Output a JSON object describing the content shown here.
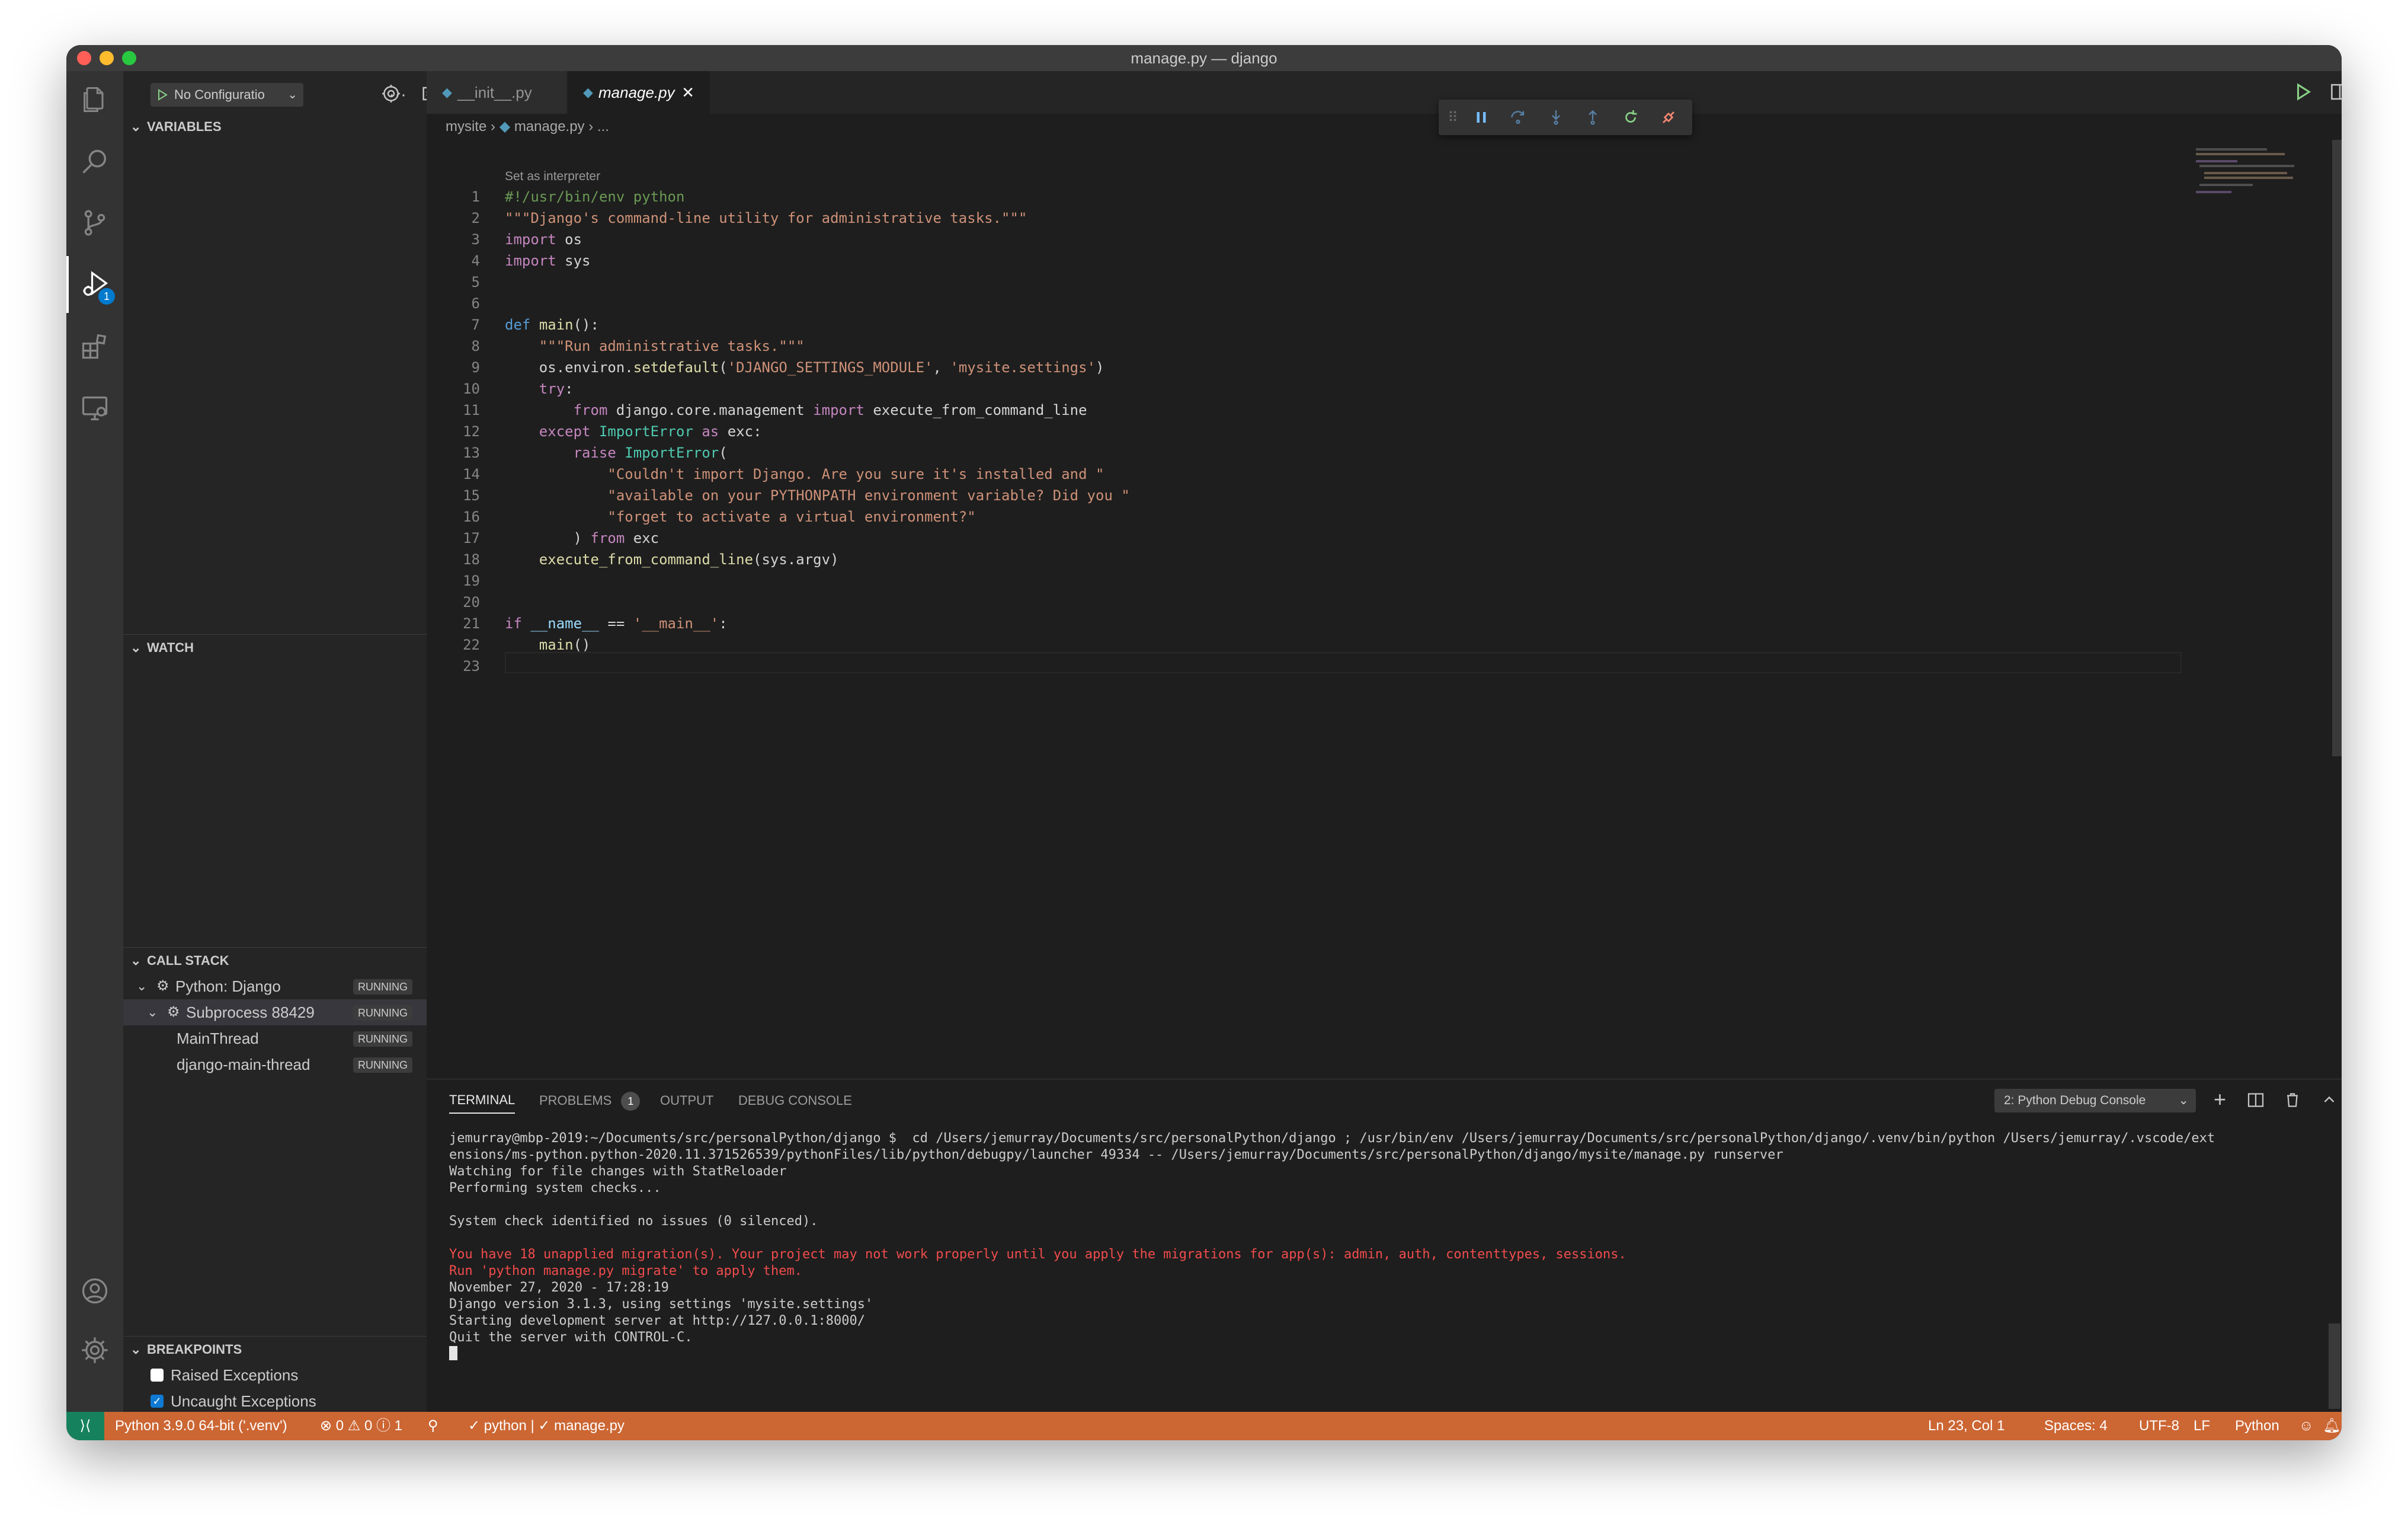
{
  "window": {
    "title": "manage.py — django",
    "traffic_colors": [
      "#ff5f57",
      "#febc2e",
      "#28c840"
    ]
  },
  "activity_bar": {
    "items": [
      {
        "name": "explorer-icon"
      },
      {
        "name": "search-icon"
      },
      {
        "name": "source-control-icon"
      },
      {
        "name": "run-debug-icon",
        "badge": "1"
      },
      {
        "name": "extensions-icon"
      },
      {
        "name": "remote-explorer-icon"
      }
    ],
    "bottom": [
      {
        "name": "accounts-icon"
      },
      {
        "name": "settings-gear-icon"
      }
    ]
  },
  "debug_toolbar": {
    "config_label": "No Configuratio"
  },
  "sidebar": {
    "variables": "VARIABLES",
    "watch": "WATCH",
    "call_stack": {
      "title": "CALL STACK",
      "rows": [
        {
          "label": "Python: Django",
          "status": "RUNNING"
        },
        {
          "label": "Subprocess 88429",
          "status": "RUNNING"
        },
        {
          "label": "MainThread",
          "status": "RUNNING"
        },
        {
          "label": "django-main-thread",
          "status": "RUNNING"
        }
      ]
    },
    "breakpoints": {
      "title": "BREAKPOINTS",
      "items": [
        {
          "label": "Raised Exceptions",
          "checked": false
        },
        {
          "label": "Uncaught Exceptions",
          "checked": true
        }
      ]
    }
  },
  "tabs": [
    {
      "label": "__init__.py",
      "active": false
    },
    {
      "label": "manage.py",
      "active": true
    }
  ],
  "breadcrumb": {
    "folder": "mysite",
    "file": "manage.py",
    "rest": "..."
  },
  "editor": {
    "hint": "Set as interpreter",
    "lines": [
      "#!/usr/bin/env python",
      "\"\"\"Django's command-line utility for administrative tasks.\"\"\"",
      "import os",
      "import sys",
      "",
      "",
      "def main():",
      "    \"\"\"Run administrative tasks.\"\"\"",
      "    os.environ.setdefault('DJANGO_SETTINGS_MODULE', 'mysite.settings')",
      "    try:",
      "        from django.core.management import execute_from_command_line",
      "    except ImportError as exc:",
      "        raise ImportError(",
      "            \"Couldn't import Django. Are you sure it's installed and \"",
      "            \"available on your PYTHONPATH environment variable? Did you \"",
      "            \"forget to activate a virtual environment?\"",
      "        ) from exc",
      "    execute_from_command_line(sys.argv)",
      "",
      "",
      "if __name__ == '__main__':",
      "    main()",
      ""
    ]
  },
  "panel": {
    "tabs": [
      "TERMINAL",
      "PROBLEMS",
      "OUTPUT",
      "DEBUG CONSOLE"
    ],
    "problems_count": "1",
    "console_select": "2: Python Debug Console",
    "terminal_lines": [
      {
        "text": "jemurray@mbp-2019:~/Documents/src/personalPython/django $  cd /Users/jemurray/Documents/src/personalPython/django ; /usr/bin/env /Users/jemurray/Documents/src/personalPython/django/.venv/bin/python /Users/jemurray/.vscode/ext",
        "color": "normal"
      },
      {
        "text": "ensions/ms-python.python-2020.11.371526539/pythonFiles/lib/python/debugpy/launcher 49334 -- /Users/jemurray/Documents/src/personalPython/django/mysite/manage.py runserver",
        "color": "normal"
      },
      {
        "text": "Watching for file changes with StatReloader",
        "color": "normal"
      },
      {
        "text": "Performing system checks...",
        "color": "normal"
      },
      {
        "text": "",
        "color": "normal"
      },
      {
        "text": "System check identified no issues (0 silenced).",
        "color": "normal"
      },
      {
        "text": "",
        "color": "normal"
      },
      {
        "text": "You have 18 unapplied migration(s). Your project may not work properly until you apply the migrations for app(s): admin, auth, contenttypes, sessions.",
        "color": "error"
      },
      {
        "text": "Run 'python manage.py migrate' to apply them.",
        "color": "error"
      },
      {
        "text": "November 27, 2020 - 17:28:19",
        "color": "normal"
      },
      {
        "text": "Django version 3.1.3, using settings 'mysite.settings'",
        "color": "normal"
      },
      {
        "text": "Starting development server at http://127.0.0.1:8000/",
        "color": "normal"
      },
      {
        "text": "Quit the server with CONTROL-C.",
        "color": "normal"
      }
    ]
  },
  "status_bar": {
    "interpreter": "Python 3.9.0 64-bit ('.venv')",
    "problems": "⊗ 0 ⚠ 0 ⓘ 1",
    "run_info": "✓ python | ✓ manage.py",
    "position": "Ln 23, Col 1",
    "spaces": "Spaces: 4",
    "encoding": "UTF-8",
    "eol": "LF",
    "language": "Python",
    "bg_color": "#cc6633"
  }
}
